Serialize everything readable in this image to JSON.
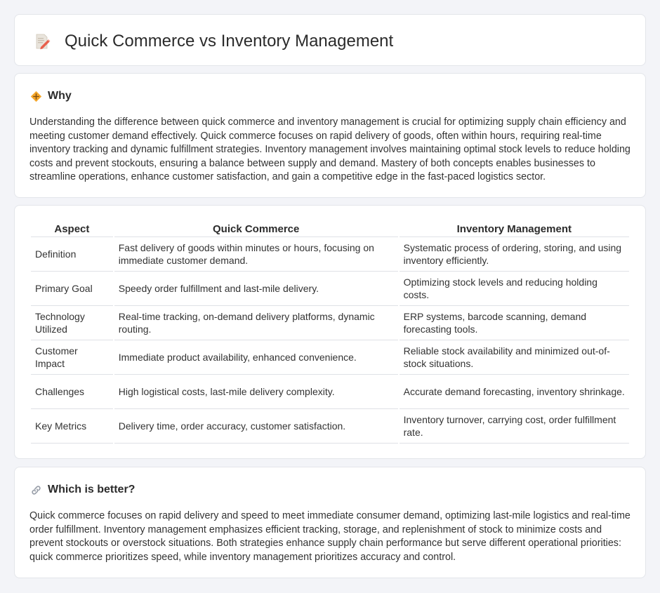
{
  "header": {
    "title": "Quick Commerce vs Inventory Management",
    "icon": "document-pencil-icon"
  },
  "why": {
    "title": "Why",
    "icon": "diamond-sign-icon",
    "text": "Understanding the difference between quick commerce and inventory management is crucial for optimizing supply chain efficiency and meeting customer demand effectively. Quick commerce focuses on rapid delivery of goods, often within hours, requiring real-time inventory tracking and dynamic fulfillment strategies. Inventory management involves maintaining optimal stock levels to reduce holding costs and prevent stockouts, ensuring a balance between supply and demand. Mastery of both concepts enables businesses to streamline operations, enhance customer satisfaction, and gain a competitive edge in the fast-paced logistics sector."
  },
  "table": {
    "headers": [
      "Aspect",
      "Quick Commerce",
      "Inventory Management"
    ],
    "rows": [
      [
        "Definition",
        "Fast delivery of goods within minutes or hours, focusing on immediate customer demand.",
        "Systematic process of ordering, storing, and using inventory efficiently."
      ],
      [
        "Primary Goal",
        "Speedy order fulfillment and last-mile delivery.",
        "Optimizing stock levels and reducing holding costs."
      ],
      [
        "Technology Utilized",
        "Real-time tracking, on-demand delivery platforms, dynamic routing.",
        "ERP systems, barcode scanning, demand forecasting tools."
      ],
      [
        "Customer Impact",
        "Immediate product availability, enhanced convenience.",
        "Reliable stock availability and minimized out-of-stock situations."
      ],
      [
        "Challenges",
        "High logistical costs, last-mile delivery complexity.",
        "Accurate demand forecasting, inventory shrinkage."
      ],
      [
        "Key Metrics",
        "Delivery time, order accuracy, customer satisfaction.",
        "Inventory turnover, carrying cost, order fulfillment rate."
      ]
    ]
  },
  "better": {
    "title": "Which is better?",
    "icon": "link-icon",
    "text": "Quick commerce focuses on rapid delivery and speed to meet immediate consumer demand, optimizing last-mile logistics and real-time order fulfillment. Inventory management emphasizes efficient tracking, storage, and replenishment of stock to minimize costs and prevent stockouts or overstock situations. Both strategies enhance supply chain performance but serve different operational priorities: quick commerce prioritizes speed, while inventory management prioritizes accuracy and control."
  },
  "colors": {
    "background": "#f3f4f8",
    "card": "#ffffff",
    "accent": "#f0a030"
  }
}
